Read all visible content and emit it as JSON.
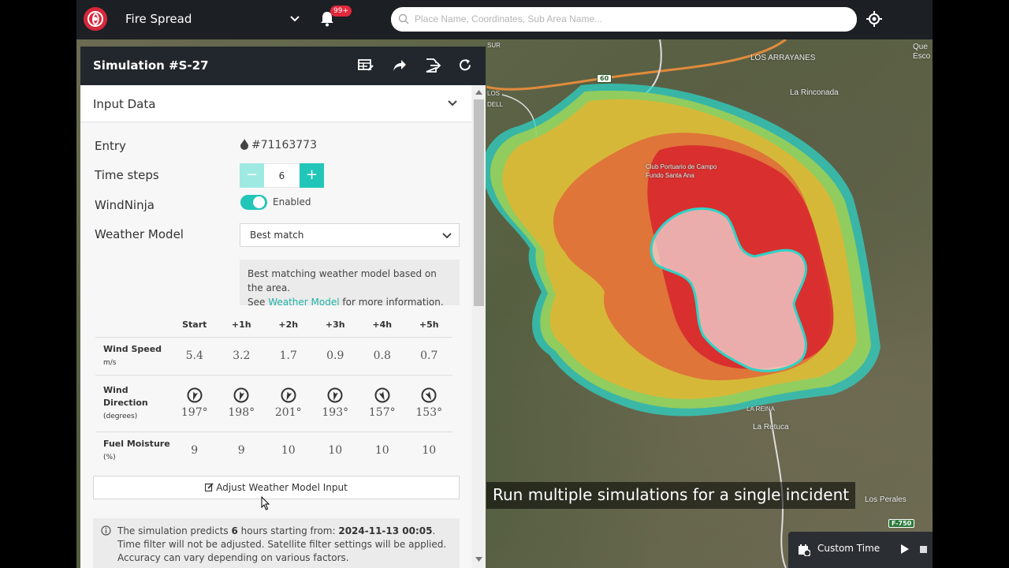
{
  "topbar": {
    "app_title": "Fire Spread",
    "notification_badge": "99+",
    "search_placeholder": "Place Name, Coordinates, Sub Area Name..."
  },
  "panel": {
    "title": "Simulation #S-27",
    "section_title": "Input Data",
    "entry_label": "Entry",
    "entry_value": "#71163773",
    "time_steps_label": "Time steps",
    "time_steps_value": "6",
    "minus_label": "−",
    "plus_label": "+",
    "windninja_label": "WindNinja",
    "windninja_state": "Enabled",
    "weather_model_label": "Weather Model",
    "weather_model_value": "Best match",
    "info_line1": "Best matching weather model based on the area.",
    "info_see": "See ",
    "info_link": "Weather Model",
    "info_rest": " for more information.",
    "weather_table": {
      "columns": [
        "Start",
        "+1h",
        "+2h",
        "+3h",
        "+4h",
        "+5h"
      ],
      "wind_speed_label": "Wind Speed",
      "wind_speed_unit": "m/s",
      "wind_speed": [
        "5.4",
        "3.2",
        "1.7",
        "0.9",
        "0.8",
        "0.7"
      ],
      "wind_direction_label": "Wind Direction",
      "wind_direction_unit": "(degrees)",
      "wind_direction": [
        "197°",
        "198°",
        "201°",
        "193°",
        "157°",
        "153°"
      ],
      "fuel_moisture_label": "Fuel Moisture",
      "fuel_moisture_unit": "(%)",
      "fuel_moisture": [
        "9",
        "9",
        "10",
        "10",
        "10",
        "10"
      ]
    },
    "adjust_button": "Adjust Weather Model Input",
    "predict_1": "The simulation predicts ",
    "predict_hours": "6",
    "predict_2": " hours starting from: ",
    "predict_time": "2024-11-13 00:05",
    "predict_3": ". Time filter will not be adjusted. Satellite filter settings will be applied. Accuracy can vary depending on various factors."
  },
  "map": {
    "labels": {
      "los_arrayanes": "LOS ARRAYANES",
      "la_rinconada": "La Rinconada",
      "club": "Club Portuario de Campo",
      "fundo": "Fundo Santa Ana",
      "la_retuca": "La Retuca",
      "los_perales": "Los Perales",
      "sur": "SUR",
      "dell": "DELL",
      "los": "LOS",
      "escol": "Esco",
      "quel": "Que",
      "reina": "LA REINA"
    },
    "shield_60": "60",
    "shield_f750": "F-750",
    "caption": "Run multiple simulations for a single incident",
    "custom_time": "Custom Time",
    "colors": {
      "zone_cyan": "#2ed3c6",
      "zone_green": "#a7d24e",
      "zone_yellow": "#e2b431",
      "zone_orange": "#e0683a",
      "zone_red": "#d8242e",
      "zone_core": "#f0d7d7"
    }
  }
}
